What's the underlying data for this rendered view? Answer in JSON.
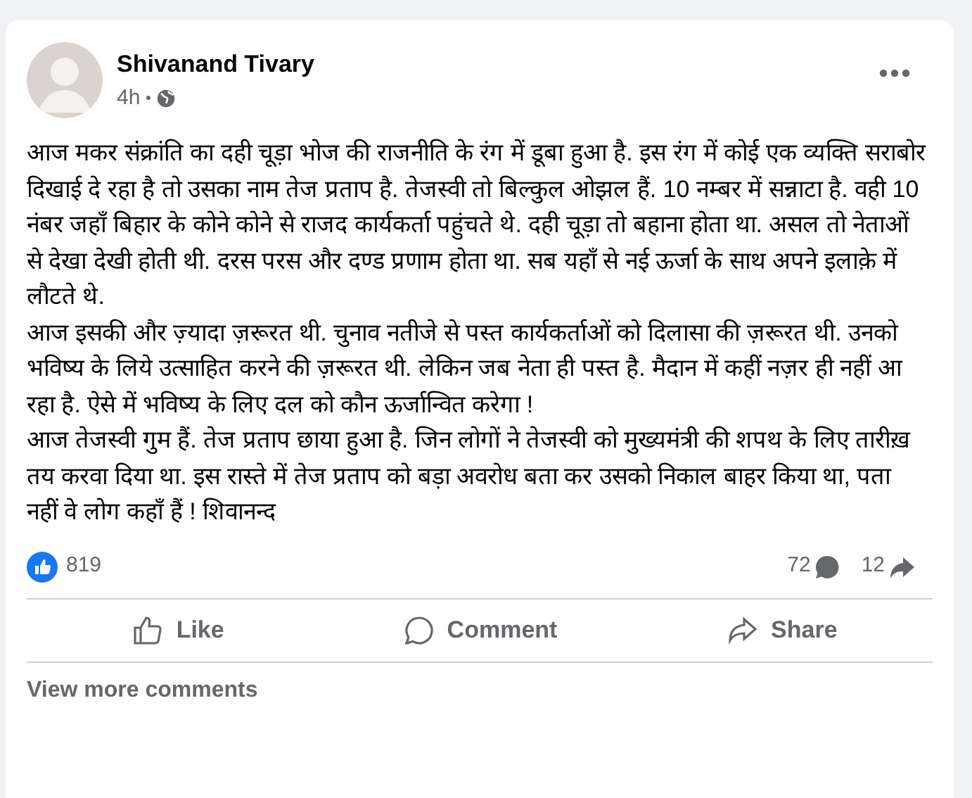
{
  "post": {
    "author": "Shivanand Tivary",
    "time": "4h",
    "paragraphs": [
      "आज मकर संक्रांति का दही चूड़ा भोज की राजनीति के रंग में डूबा हुआ है. इस रंग में कोई एक व्यक्ति सराबोर दिखाई दे रहा है तो उसका नाम तेज प्रताप है. तेजस्वी तो बिल्कुल ओझल हैं. 10 नम्बर में सन्नाटा है. वही 10 नंबर जहाँ बिहार के कोने कोने से राजद कार्यकर्ता पहुंचते थे. दही चूड़ा तो बहाना होता था. असल तो नेताओं से देखा देखी होती थी. दरस परस और दण्ड प्रणाम होता था. सब यहाँ से नई ऊर्जा के साथ अपने इलाक़े में लौटते थे.",
      "आज इसकी और ज़्यादा ज़रूरत थी. चुनाव नतीजे से पस्त कार्यकर्ताओं को दिलासा की ज़रूरत थी. उनको भविष्य के लिये उत्साहित करने की ज़रूरत थी. लेकिन जब नेता ही पस्त है. मैदान में कहीं नज़र ही नहीं आ रहा है. ऐसे में भविष्य के लिए दल को कौन ऊर्जान्वित करेगा !",
      "आज तेजस्वी गुम हैं. तेज प्रताप छाया हुआ है. जिन लोगों ने तेजस्वी को मुख्यमंत्री की शपथ के लिए तारीख़ तय करवा दिया था. इस रास्ते में तेज प्रताप को बड़ा अवरोध बता कर उसको निकाल बाहर किया था, पता नहीं वे लोग कहाँ हैं ! शिवानन्द"
    ]
  },
  "stats": {
    "reactions": "819",
    "comments": "72",
    "shares": "12"
  },
  "actions": [
    "Like",
    "Comment",
    "Share"
  ],
  "view_more": "View more comments"
}
